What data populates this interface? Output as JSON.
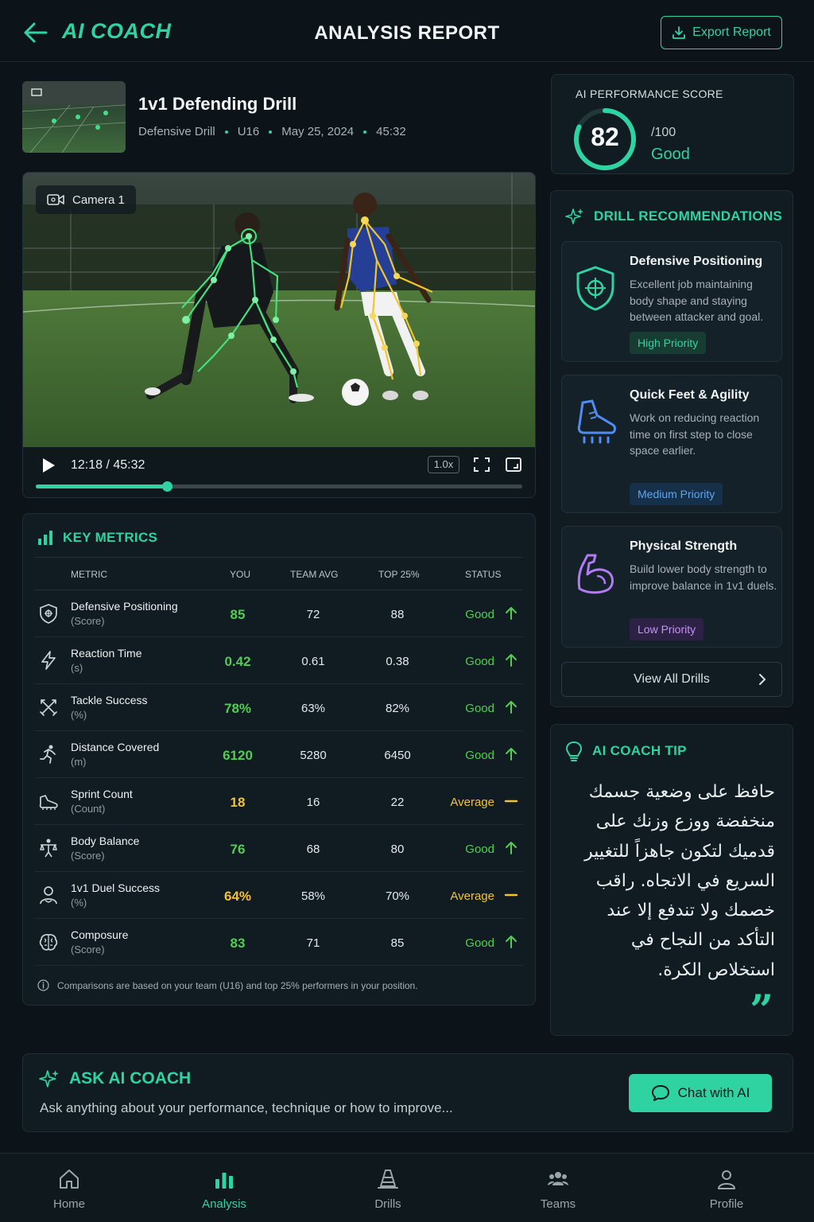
{
  "header": {
    "brand": "AI COACH",
    "title": "ANALYSIS REPORT",
    "export_label": "Export Report"
  },
  "drill": {
    "title": "1v1 Defending Drill",
    "type": "Defensive Drill",
    "group": "U16",
    "date": "May 25, 2024",
    "duration": "45:32"
  },
  "video": {
    "camera_label": "Camera 1",
    "time": "12:18 / 45:32",
    "speed": "1.0x",
    "progress": 0.27
  },
  "metrics": {
    "title": "KEY METRICS",
    "columns": [
      "METRIC",
      "YOU",
      "TEAM AVG",
      "TOP 25%",
      "STATUS"
    ],
    "rows": [
      {
        "name": "Defensive Positioning",
        "unit": "(Score)",
        "you": "85",
        "team_avg": "72",
        "top25": "88",
        "status": "Good",
        "icon": "shield-icon"
      },
      {
        "name": "Reaction Time",
        "unit": "(s)",
        "you": "0.42",
        "team_avg": "0.61",
        "top25": "0.38",
        "status": "Good",
        "icon": "lightning-icon"
      },
      {
        "name": "Tackle Success",
        "unit": "(%)",
        "you": "78%",
        "team_avg": "63%",
        "top25": "82%",
        "status": "Good",
        "icon": "crossed-swords-icon"
      },
      {
        "name": "Distance Covered",
        "unit": "(m)",
        "you": "6120",
        "team_avg": "5280",
        "top25": "6450",
        "status": "Good",
        "icon": "runner-icon"
      },
      {
        "name": "Sprint Count",
        "unit": "(Count)",
        "you": "18",
        "team_avg": "16",
        "top25": "22",
        "status": "Average",
        "icon": "shoe-icon"
      },
      {
        "name": "Body Balance",
        "unit": "(Score)",
        "you": "76",
        "team_avg": "68",
        "top25": "80",
        "status": "Good",
        "icon": "balance-icon"
      },
      {
        "name": "1v1 Duel Success",
        "unit": "(%)",
        "you": "64%",
        "team_avg": "58%",
        "top25": "70%",
        "status": "Average",
        "icon": "person-icon"
      },
      {
        "name": "Composure",
        "unit": "(Score)",
        "you": "83",
        "team_avg": "71",
        "top25": "85",
        "status": "Good",
        "icon": "brain-icon"
      }
    ],
    "note": "Comparisons are based on your team (U16) and top 25% performers in your position."
  },
  "score": {
    "label": "AI PERFORMANCE SCORE",
    "value": "82",
    "max": "/100",
    "rating": "Good",
    "fraction": 0.82
  },
  "recommendations": {
    "title": "DRILL RECOMMENDATIONS",
    "items": [
      {
        "title": "Defensive Positioning",
        "desc": "Excellent job maintaining body shape and staying between attacker and goal.",
        "priority": "High Priority"
      },
      {
        "title": "Quick Feet & Agility",
        "desc": "Work on reducing reaction time on first step to close space earlier.",
        "priority": "Medium Priority"
      },
      {
        "title": "Physical Strength",
        "desc": "Build lower body strength to improve balance in 1v1 duels.",
        "priority": "Low Priority"
      }
    ],
    "view_all": "View All Drills"
  },
  "tip": {
    "title": "AI COACH TIP",
    "text": "حافظ على وضعية جسمك منخفضة ووزع وزنك على قدميك لتكون جاهزاً للتغيير السريع في الاتجاه. راقب خصمك ولا تندفع إلا عند التأكد من النجاح في استخلاص الكرة.",
    "quote_mark": "”"
  },
  "ask": {
    "title": "ASK AI COACH",
    "subtitle": "Ask anything about your performance, technique or how to improve...",
    "button": "Chat with AI"
  },
  "nav": {
    "items": [
      {
        "label": "Home"
      },
      {
        "label": "Analysis"
      },
      {
        "label": "Drills"
      },
      {
        "label": "Teams"
      },
      {
        "label": "Profile"
      }
    ]
  },
  "colors": {
    "accent": "#2fd3a2",
    "good": "#4fce52",
    "average": "#f2c230",
    "background": "#0c1419"
  }
}
